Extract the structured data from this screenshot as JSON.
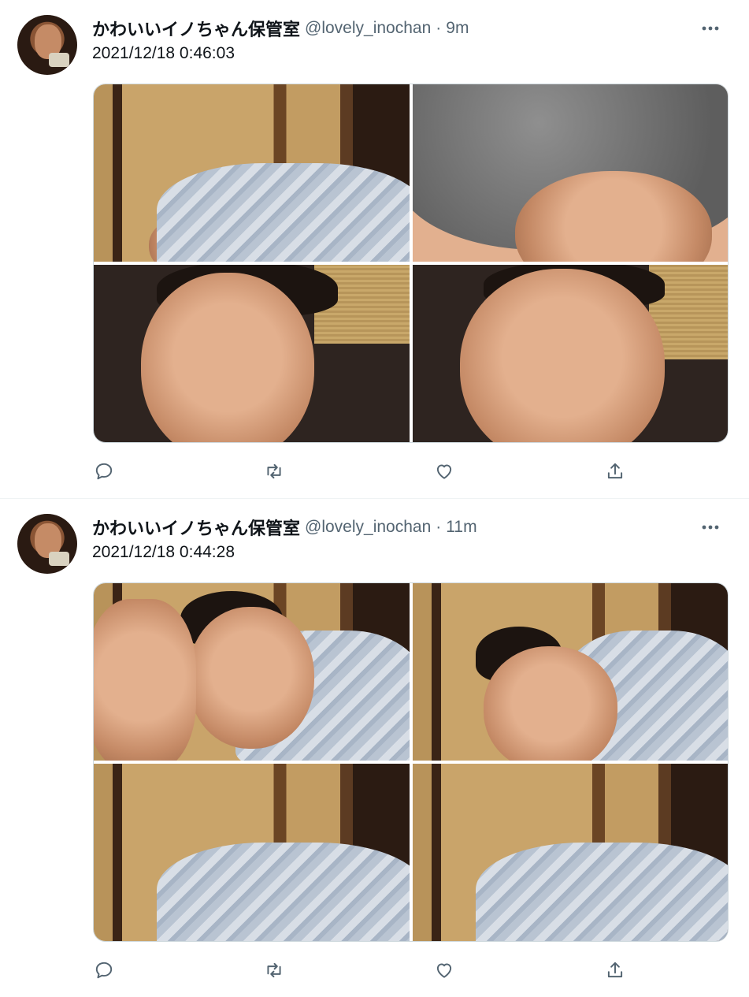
{
  "tweets": [
    {
      "author_name": "かわいいイノちゃん保管室",
      "handle": "@lovely_inochan",
      "separator": "·",
      "time": "9m",
      "text": "2021/12/18 0:46:03"
    },
    {
      "author_name": "かわいいイノちゃん保管室",
      "handle": "@lovely_inochan",
      "separator": "·",
      "time": "11m",
      "text": "2021/12/18 0:44:28"
    }
  ],
  "icons": {
    "more": "more-horizontal-icon",
    "reply": "reply-icon",
    "retweet": "retweet-icon",
    "like": "like-icon",
    "share": "share-icon"
  },
  "colors": {
    "text": "#0f1419",
    "secondary": "#536471",
    "border": "#cfd9de"
  }
}
